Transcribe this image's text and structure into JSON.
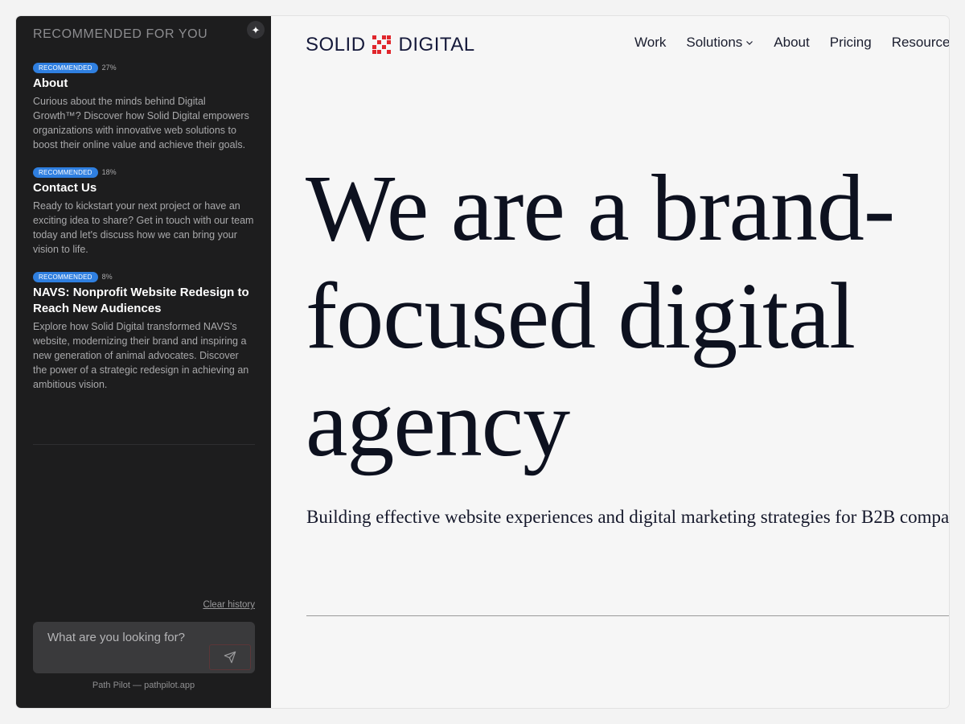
{
  "sidebar": {
    "header": "RECOMMENDED FOR YOU",
    "sparkle_icon": "sparkle-icon",
    "items": [
      {
        "badge": "RECOMMENDED",
        "percent": "27%",
        "title": "About",
        "description": "Curious about the minds behind Digital Growth™? Discover how Solid Digital empowers organizations with innovative web solutions to boost their online value and achieve their goals."
      },
      {
        "badge": "RECOMMENDED",
        "percent": "18%",
        "title": "Contact Us",
        "description": "Ready to kickstart your next project or have an exciting idea to share? Get in touch with our team today and let's discuss how we can bring your vision to life."
      },
      {
        "badge": "RECOMMENDED",
        "percent": "8%",
        "title": "NAVS: Nonprofit Website Redesign to Reach New Audiences",
        "description": "Explore how Solid Digital transformed NAVS's website, modernizing their brand and inspiring a new generation of animal advocates. Discover the power of a strategic redesign in achieving an ambitious vision."
      }
    ],
    "clear_history": "Clear history",
    "search": {
      "placeholder": "What are you looking for?",
      "value": ""
    },
    "send_icon": "send-icon",
    "footer": "Path Pilot — pathpilot.app"
  },
  "site": {
    "logo_left": "SOLID",
    "logo_right": "DIGITAL",
    "nav": [
      "Work",
      "Solutions",
      "About",
      "Pricing",
      "Resources"
    ],
    "hero_line1": "We are a brand-",
    "hero_line2": "focused digital",
    "hero_line3": "agency",
    "subtitle": "Building effective website experiences and digital marketing strategies for B2B compa"
  },
  "colors": {
    "sidebar_bg": "#1d1d1e",
    "badge_blue": "#2f7fe0",
    "brand_red": "#e0262c",
    "brand_navy": "#15193a",
    "page_bg": "#f6f6f6"
  }
}
